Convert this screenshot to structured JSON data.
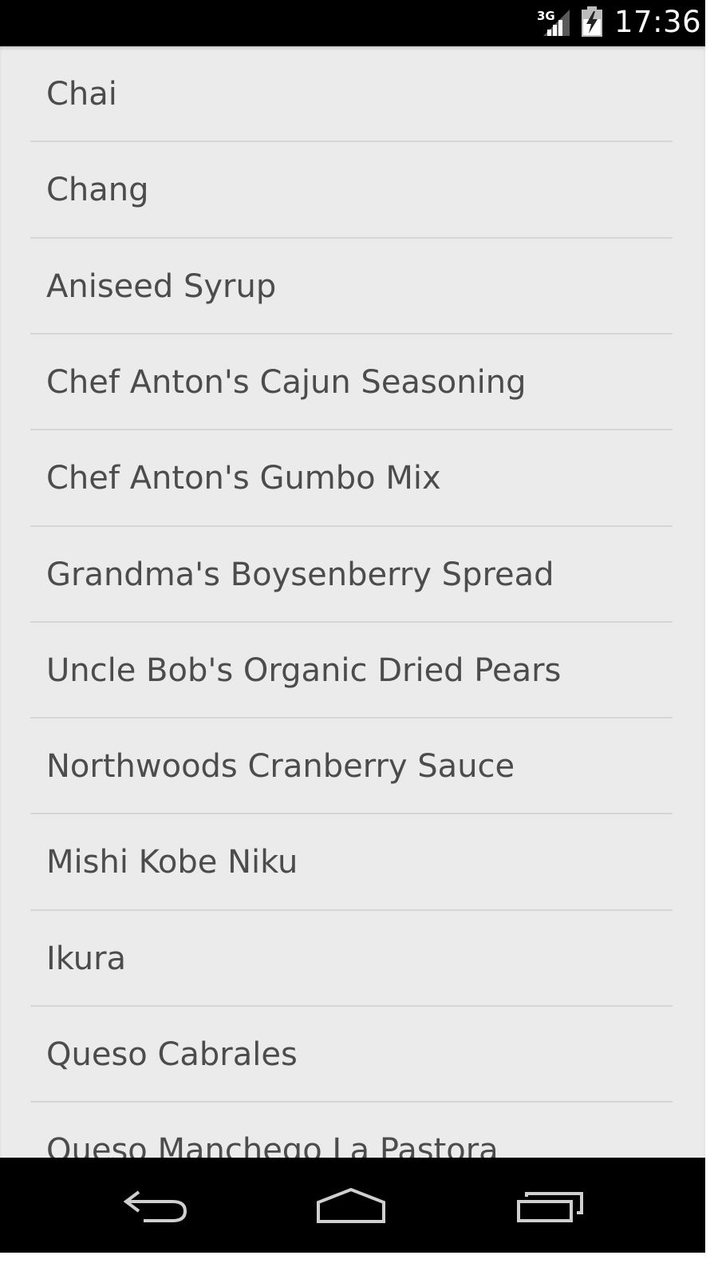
{
  "status_bar": {
    "network_label": "3G",
    "time": "17:36",
    "icons": [
      "signal-icon",
      "battery-icon"
    ]
  },
  "list": {
    "items": [
      {
        "label": "Chai"
      },
      {
        "label": "Chang"
      },
      {
        "label": "Aniseed Syrup"
      },
      {
        "label": "Chef Anton's Cajun Seasoning"
      },
      {
        "label": "Chef Anton's Gumbo Mix"
      },
      {
        "label": "Grandma's Boysenberry Spread"
      },
      {
        "label": "Uncle Bob's Organic Dried Pears"
      },
      {
        "label": "Northwoods Cranberry Sauce"
      },
      {
        "label": "Mishi Kobe Niku"
      },
      {
        "label": "Ikura"
      },
      {
        "label": "Queso Cabrales"
      },
      {
        "label": "Queso Manchego La Pastora"
      }
    ]
  },
  "nav_bar": {
    "buttons": [
      "back-icon",
      "home-icon",
      "recent-apps-icon"
    ]
  },
  "colors": {
    "background": "#ebebeb",
    "text": "#4c4c4c",
    "divider": "#d6d6d6",
    "bars": "#000000"
  }
}
